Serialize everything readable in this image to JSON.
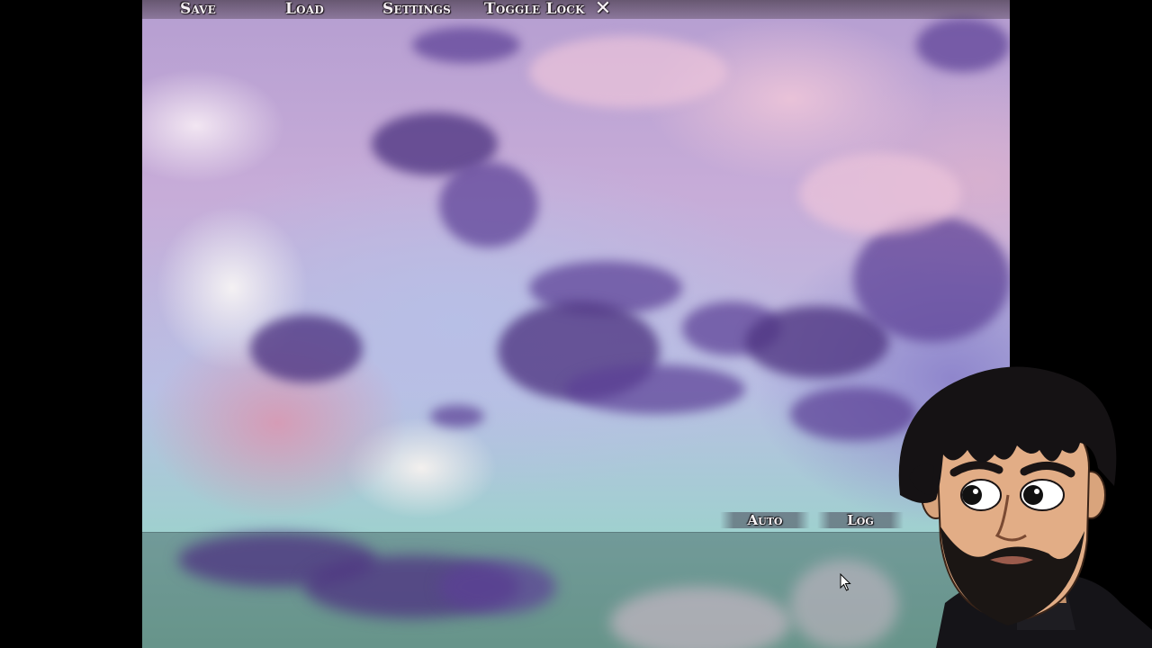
{
  "quick_menu": {
    "save_label": "Save",
    "load_label": "Load",
    "settings_label": "Settings",
    "toggle_lock_label": "Toggle Lock",
    "close_symbol": "✕"
  },
  "controls": {
    "auto_label": "Auto",
    "log_label": "Log"
  },
  "icons": {
    "close": "close-icon",
    "cursor": "mouse-pointer-icon"
  },
  "colors": {
    "page_background": "#000000",
    "menu_text": "#f6f0f4",
    "sky_top": "#b59ed1",
    "sky_bottom": "#8fc8b8",
    "cloud_dark": "#5c4096"
  }
}
